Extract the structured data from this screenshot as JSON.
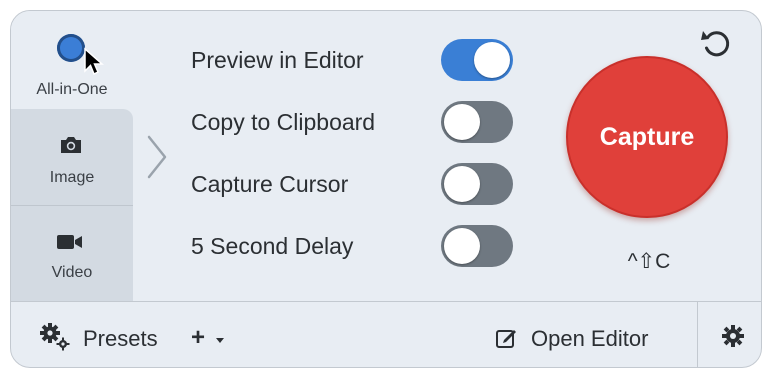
{
  "modes": {
    "all_in_one": "All-in-One",
    "image": "Image",
    "video": "Video",
    "selected": "All-in-One"
  },
  "options": [
    {
      "label": "Preview in Editor",
      "enabled": true
    },
    {
      "label": "Copy to Clipboard",
      "enabled": false
    },
    {
      "label": "Capture Cursor",
      "enabled": false
    },
    {
      "label": "5 Second Delay",
      "enabled": false
    }
  ],
  "capture": {
    "label": "Capture",
    "shortcut": "^⇧C"
  },
  "bottom": {
    "presets_label": "Presets",
    "add_label": "+",
    "open_editor_label": "Open Editor"
  },
  "colors": {
    "accent": "#3a7fd5",
    "capture": "#e0403a",
    "toggle_off": "#6f7881",
    "panel_bg": "#e8edf3",
    "tab_bg": "#d3dae2"
  },
  "icons": [
    "cursor-icon",
    "camera-icon",
    "video-camera-icon",
    "chevron-right-icon",
    "refresh-icon",
    "gear-icon",
    "edit-icon",
    "caret-down-icon"
  ]
}
